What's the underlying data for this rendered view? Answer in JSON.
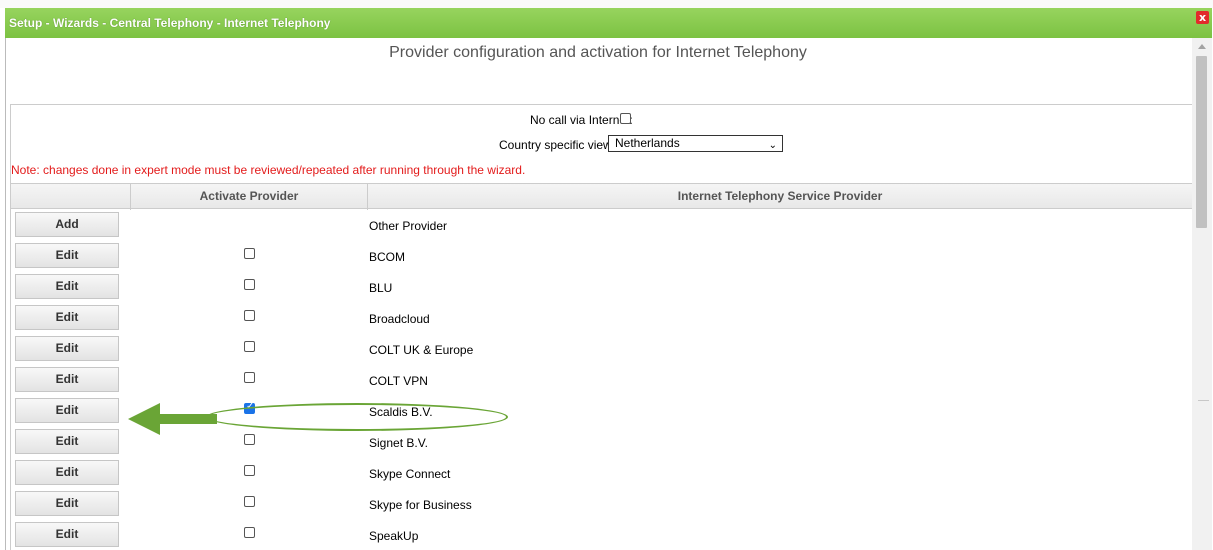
{
  "window": {
    "title": "Setup - Wizards - Central Telephony - Internet Telephony",
    "close_glyph": "x"
  },
  "header": {
    "title": "Provider configuration and activation for Internet Telephony"
  },
  "settings": {
    "no_call_label": "No call via Internet:",
    "no_call_checked": false,
    "country_label": "Country specific view:",
    "country_value": "Netherlands",
    "note": "Note: changes done in expert mode must be reviewed/repeated after running through the wizard."
  },
  "table": {
    "columns": [
      "",
      "Activate Provider",
      "Internet Telephony Service Provider"
    ],
    "rows": [
      {
        "button": "Add",
        "checkbox": null,
        "provider": "Other Provider"
      },
      {
        "button": "Edit",
        "checkbox": false,
        "provider": "BCOM"
      },
      {
        "button": "Edit",
        "checkbox": false,
        "provider": "BLU"
      },
      {
        "button": "Edit",
        "checkbox": false,
        "provider": "Broadcloud"
      },
      {
        "button": "Edit",
        "checkbox": false,
        "provider": "COLT UK & Europe"
      },
      {
        "button": "Edit",
        "checkbox": false,
        "provider": "COLT VPN"
      },
      {
        "button": "Edit",
        "checkbox": true,
        "provider": "Scaldis B.V."
      },
      {
        "button": "Edit",
        "checkbox": false,
        "provider": "Signet B.V."
      },
      {
        "button": "Edit",
        "checkbox": false,
        "provider": "Skype Connect"
      },
      {
        "button": "Edit",
        "checkbox": false,
        "provider": "Skype for Business"
      },
      {
        "button": "Edit",
        "checkbox": false,
        "provider": "SpeakUp"
      }
    ]
  },
  "annotation": {
    "arrow_color": "#6aa536",
    "highlight_color": "#6aa536"
  },
  "colors": {
    "titlebar": "#7cc242",
    "note": "#e31b1b",
    "checked": "#1a73e8"
  }
}
